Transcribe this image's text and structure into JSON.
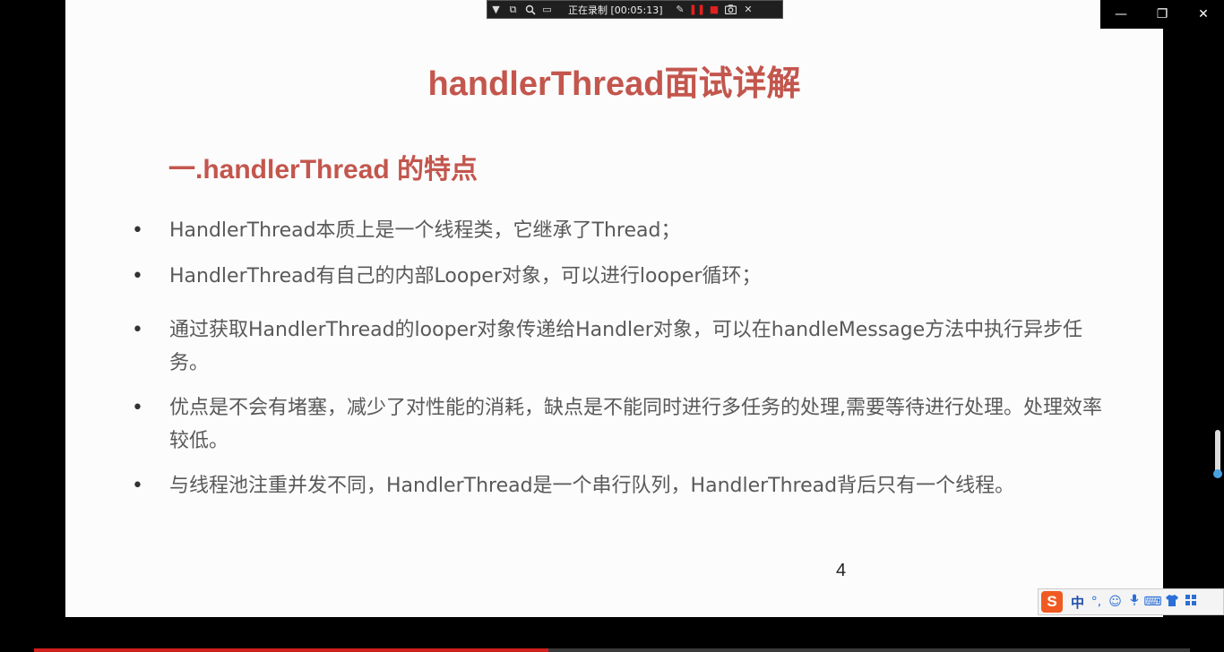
{
  "slide": {
    "title": "handlerThread面试详解",
    "subtitle": "一.handlerThread 的特点",
    "bullet_symbol": "•",
    "bullets": [
      "HandlerThread本质上是一个线程类，它继承了Thread；",
      "HandlerThread有自己的内部Looper对象，可以进行looper循环；",
      "通过获取HandlerThread的looper对象传递给Handler对象，可以在handleMessage方法中执行异步任务。",
      "优点是不会有堵塞，减少了对性能的消耗，缺点是不能同时进行多任务的处理,需要等待进行处理。处理效率较低。",
      "与线程池注重并发不同，HandlerThread是一个串行队列，HandlerThread背后只有一个线程。"
    ],
    "page_number": "4"
  },
  "recorder": {
    "status": "正在录制 [00:05:13]",
    "icons": [
      "dropdown-icon",
      "window-icon",
      "zoom-icon",
      "region-icon",
      "pen-icon",
      "pause-icon",
      "stop-icon",
      "camera-icon",
      "close-icon"
    ]
  },
  "window_controls": {
    "minimize": "—",
    "restore": "❐",
    "close": "✕"
  },
  "ime": {
    "logo": "S",
    "mode": "中",
    "punct": "°,",
    "icons": [
      "emoji-icon",
      "mic-icon",
      "keyboard-icon",
      "skin-icon",
      "grid-icon"
    ]
  },
  "video_progress": {
    "fraction": 0.445
  },
  "colors": {
    "accent": "#c3564d",
    "progress": "#d0201d"
  }
}
